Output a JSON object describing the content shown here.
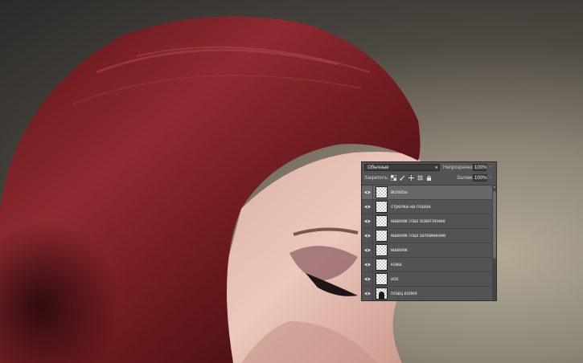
{
  "canvas": {
    "subject": "portrait photo with red hair",
    "colors": {
      "hair": "#7a1f24",
      "skin": "#e3bfb3",
      "background": "#5c5750"
    }
  },
  "layers_panel": {
    "blend_mode": "Обычные",
    "opacity_label": "Непрозрачность:",
    "opacity_value": "100%",
    "lock_label": "Закрепить:",
    "fill_label": "Заливка:",
    "fill_value": "100%",
    "lock_icons": [
      "transparency-lock-icon",
      "brush-lock-icon",
      "move-lock-icon",
      "artboard-lock-icon",
      "padlock-icon"
    ],
    "layers": [
      {
        "name": "волосы",
        "visible": true,
        "selected": true
      },
      {
        "name": "стрелка на глазах",
        "visible": true,
        "selected": false
      },
      {
        "name": "макияж глаз осветление",
        "visible": true,
        "selected": false
      },
      {
        "name": "макияж глаз затемнение",
        "visible": true,
        "selected": false
      },
      {
        "name": "макияж",
        "visible": true,
        "selected": false
      },
      {
        "name": "кожа",
        "visible": true,
        "selected": false
      },
      {
        "name": "нос",
        "visible": true,
        "selected": false
      },
      {
        "name": "плащ копия",
        "visible": true,
        "selected": false
      }
    ]
  }
}
